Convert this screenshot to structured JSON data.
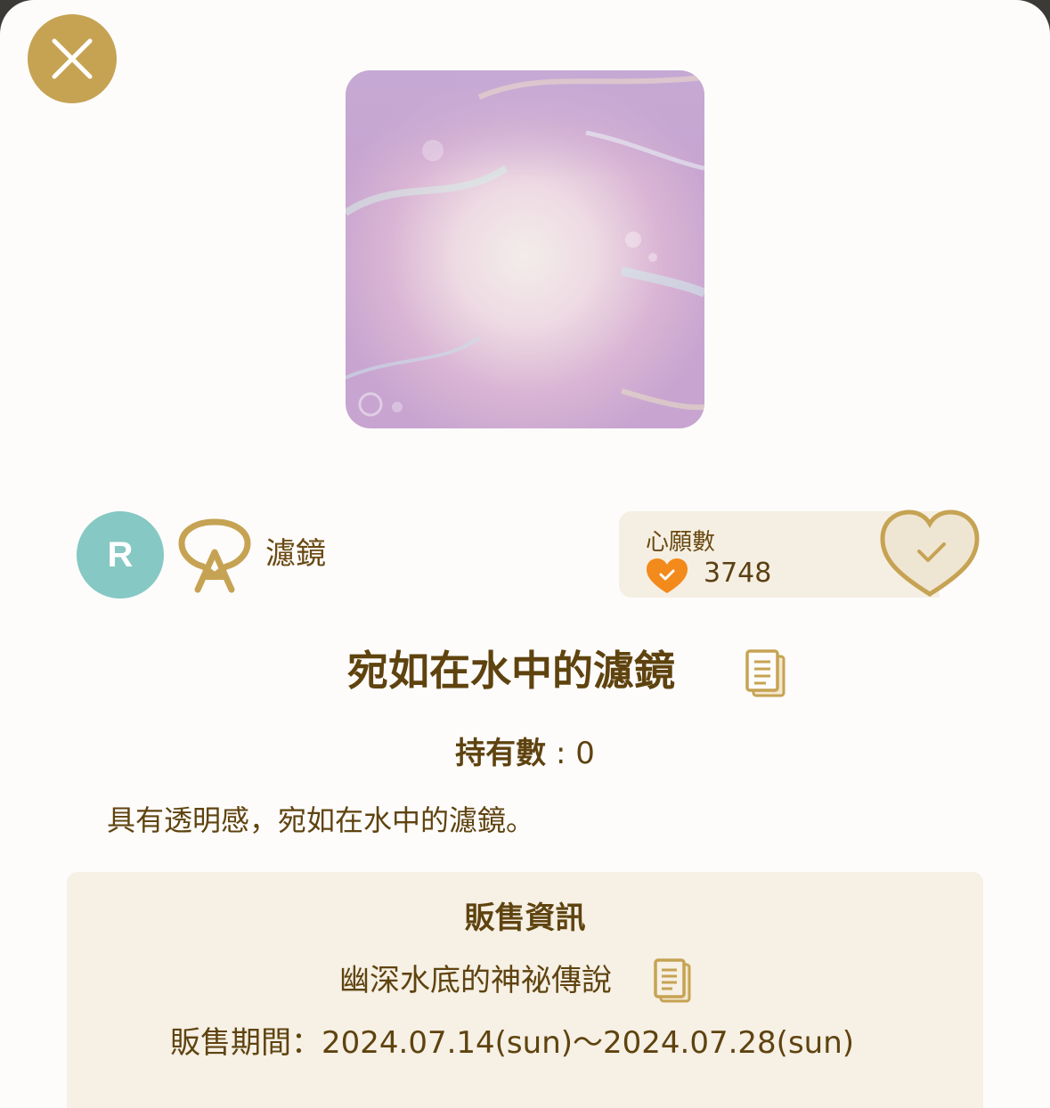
{
  "close_icon": "close-icon",
  "item": {
    "rarity": "R",
    "category_icon": "filter-icon",
    "category": "濾鏡",
    "title": "宛如在水中的濾鏡",
    "title_icon": "document-icon",
    "owned_label": "持有數",
    "owned_separator": " : ",
    "owned_count": "0",
    "description": "具有透明感，宛如在水中的濾鏡。"
  },
  "wish": {
    "label": "心願數",
    "count": "3748",
    "count_icon": "heart-check-icon",
    "button_icon": "heart-check-icon"
  },
  "sale": {
    "heading": "販售資訊",
    "set_name": "幽深水底的神祕傳說",
    "set_icon": "document-icon",
    "period_label": "販售期間：",
    "period": "2024.07.14(sun)～2024.07.28(sun)"
  },
  "colors": {
    "gold": "#c6a353",
    "brown_text": "#5f430f",
    "rarity_teal": "#86c8c3",
    "panel_beige": "#f6f0e5",
    "heart_orange": "#f28a1c"
  }
}
